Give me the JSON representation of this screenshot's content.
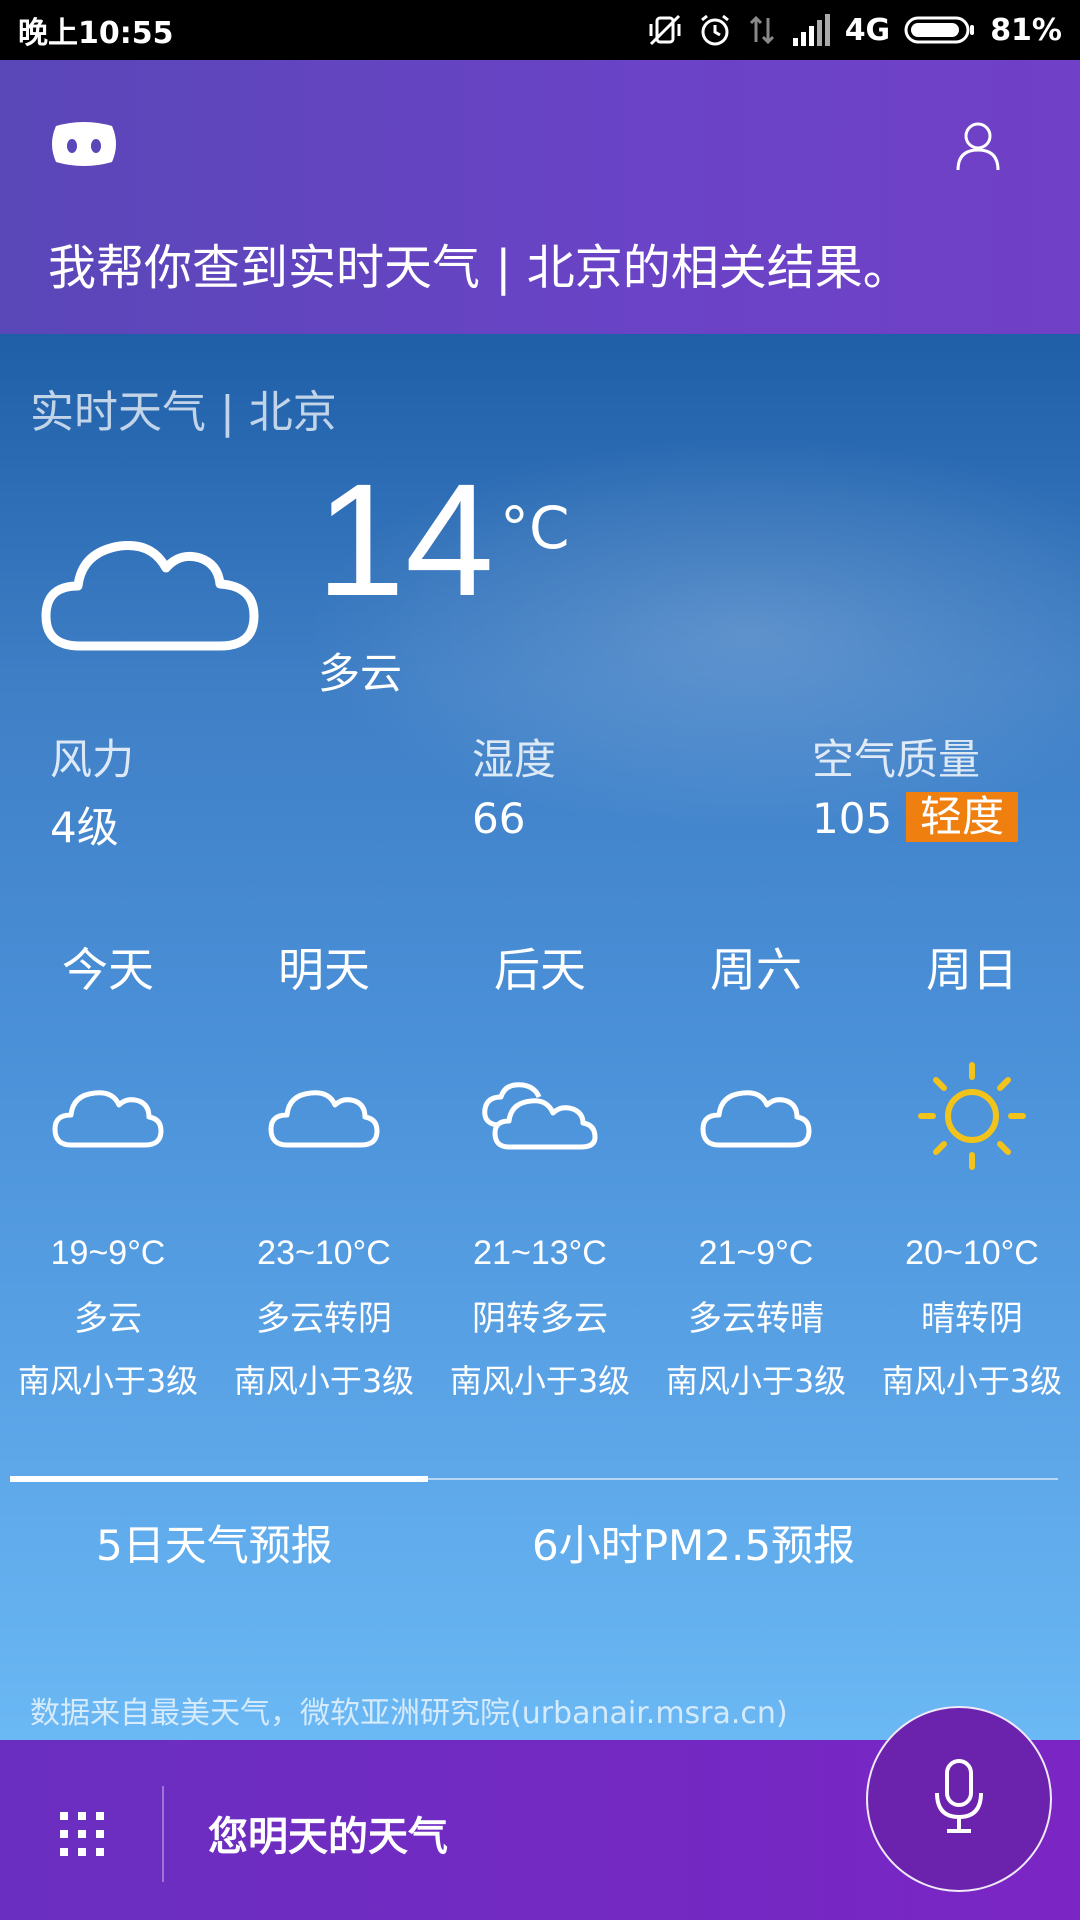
{
  "status_bar": {
    "time": "晚上10:55",
    "network": "4G",
    "battery": "81%"
  },
  "header": {
    "response_text": "我帮你查到实时天气 | 北京的相关结果。"
  },
  "weather": {
    "title": "实时天气 | 北京",
    "current": {
      "temperature": "14",
      "unit": "°C",
      "condition": "多云",
      "icon": "cloud-icon"
    },
    "metrics": {
      "wind_label": "风力",
      "wind_value": "4级",
      "humidity_label": "湿度",
      "humidity_value": "66",
      "aqi_label": "空气质量",
      "aqi_value": "105",
      "aqi_level": "轻度",
      "aqi_color": "#ef7f0e"
    },
    "forecast": [
      {
        "day": "今天",
        "icon": "cloud-icon",
        "range": "19~9°C",
        "desc": "多云",
        "wind": "南风小于3级"
      },
      {
        "day": "明天",
        "icon": "cloud-icon",
        "range": "23~10°C",
        "desc": "多云转阴",
        "wind": "南风小于3级"
      },
      {
        "day": "后天",
        "icon": "overcast-icon",
        "range": "21~13°C",
        "desc": "阴转多云",
        "wind": "南风小于3级"
      },
      {
        "day": "周六",
        "icon": "cloud-icon",
        "range": "21~9°C",
        "desc": "多云转晴",
        "wind": "南风小于3级"
      },
      {
        "day": "周日",
        "icon": "sun-icon",
        "range": "20~10°C",
        "desc": "晴转阴",
        "wind": "南风小于3级"
      }
    ],
    "tabs": {
      "five_day": "5日天气预报",
      "pm25": "6小时PM2.5预报",
      "active": "five_day"
    },
    "source": "数据来自最美天气，微软亚洲研究院(urbanair.msra.cn)"
  },
  "bottom_bar": {
    "query_text": "您明天的天气"
  },
  "colors": {
    "header": "#5a47b8",
    "bottom": "#7a25c4",
    "sun": "#f2c31a"
  }
}
